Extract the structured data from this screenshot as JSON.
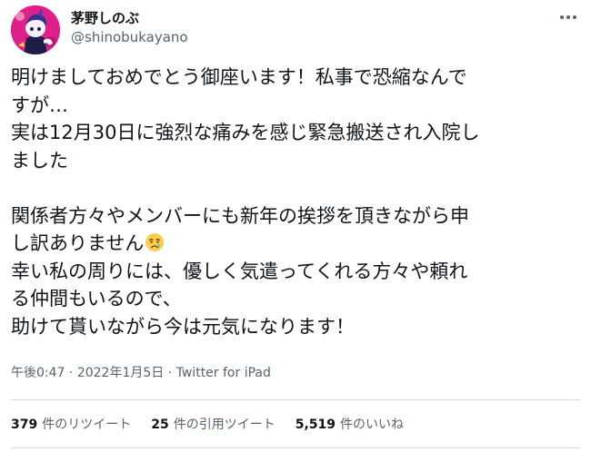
{
  "user": {
    "display_name": "茅野しのぶ",
    "handle": "@shinobukayano",
    "avatar_icon": "character-avatar"
  },
  "more_icon": "more-dots-icon",
  "tweet": {
    "lines": [
      "明けましておめでとう御座います！私事で恐縮なんで",
      "すが…",
      "実は12月30日に強烈な痛みを感じ緊急搬送され入院し",
      "ました",
      "",
      "関係者方々やメンバーにも新年の挨拶を頂きながら申",
      "し訳ありません",
      "幸い私の周りには、優しく気遣ってくれる方々や頼れ",
      "る仲間もいるので、",
      "助けて貰いながら今は元気になります！"
    ],
    "emoji": "crying-face-emoji"
  },
  "meta": {
    "time": "午後0:47",
    "sep1": " · ",
    "date": "2022年1月5日",
    "sep2": " · ",
    "source": "Twitter for iPad"
  },
  "stats": {
    "retweets_count": "379",
    "retweets_label": "件のリツイート",
    "quotes_count": "25",
    "quotes_label": "件の引用ツイート",
    "likes_count": "5,519",
    "likes_label": "件のいいね"
  },
  "colors": {
    "text": "#0f1419",
    "secondary": "#536471",
    "divider": "#cfd9de",
    "avatar_bg": "#e0208a"
  }
}
